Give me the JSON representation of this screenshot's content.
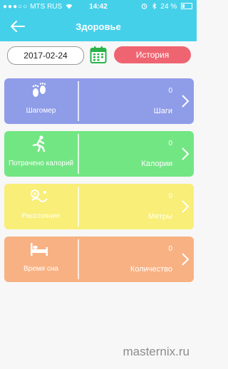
{
  "status_bar": {
    "carrier": "MTS RUS",
    "time": "14:42",
    "battery": "24 %",
    "battery_level": 0.24
  },
  "header": {
    "title": "Здоровье"
  },
  "controls": {
    "date": "2017-02-24",
    "history_label": "История"
  },
  "cards": [
    {
      "name": "Шагомер",
      "value": "0",
      "unit": "Шаги",
      "color": "#8f9ce8",
      "icon": "footprints-icon"
    },
    {
      "name": "Потрачено калорий",
      "value": "0",
      "unit": "Калории",
      "color": "#73e684",
      "icon": "runner-icon"
    },
    {
      "name": "Расстояние",
      "value": "0",
      "unit": "Метры",
      "color": "#f8ee78",
      "icon": "distance-icon"
    },
    {
      "name": "Время сна",
      "value": "0",
      "unit": "Количество",
      "color": "#f8b182",
      "icon": "bed-icon"
    }
  ],
  "watermark": "masternix.ru",
  "colors": {
    "header": "#45d0ea",
    "history_button": "#ef6471",
    "calendar": "#2bb34a"
  }
}
